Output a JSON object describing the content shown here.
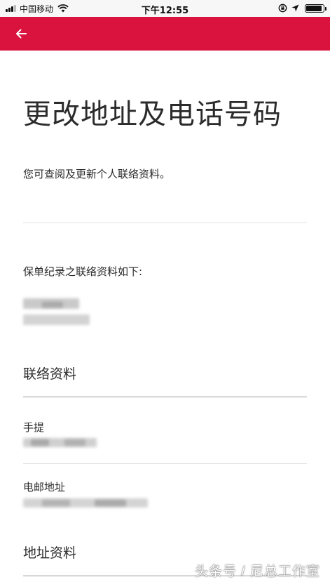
{
  "status_bar": {
    "carrier": "中国移动",
    "time": "下午12:55",
    "battery_level": 0.9,
    "icons": [
      "signal-icon",
      "wifi-icon",
      "orientation-lock-icon",
      "location-arrow-icon",
      "battery-icon"
    ]
  },
  "app_bar": {
    "background_color": "#d9123e",
    "back_icon": "arrow-left-icon"
  },
  "page": {
    "title": "更改地址及电话号码",
    "intro": "您可查阅及更新个人联络资料。",
    "record_label": "保单纪录之联络资料如下:",
    "contact_section": {
      "heading": "联络资料",
      "fields": [
        {
          "label": "手提"
        },
        {
          "label": "电邮地址"
        }
      ]
    },
    "address_section": {
      "heading": "地址资料"
    }
  },
  "watermark": "头条号 / 尼总工作室"
}
